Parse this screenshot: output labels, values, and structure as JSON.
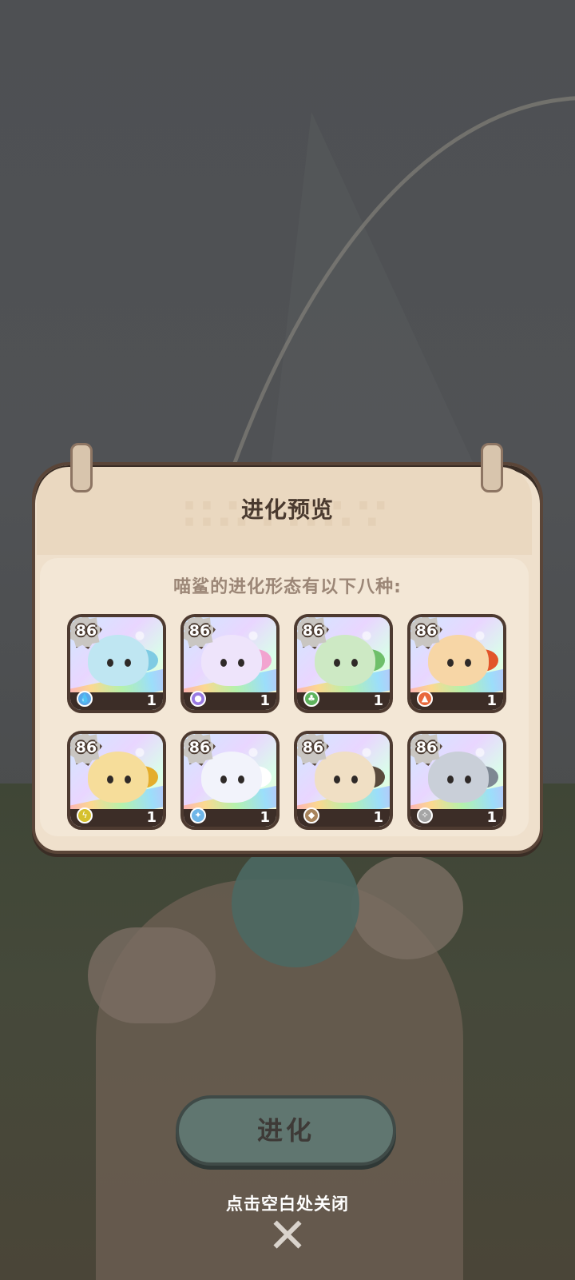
{
  "dialog": {
    "title": "进化预览",
    "subtitle": "喵鲨的进化形态有以下八种:",
    "cards": [
      {
        "level": "86",
        "count": "1",
        "element_icon": "water-icon",
        "element_color": "#5aa7e8",
        "body_color": "#bfe6f2",
        "tail_color": "#7fcbe3"
      },
      {
        "level": "86",
        "count": "1",
        "element_icon": "psychic-icon",
        "element_color": "#9a7be3",
        "body_color": "#eee4fb",
        "tail_color": "#f2a4d0"
      },
      {
        "level": "86",
        "count": "1",
        "element_icon": "grass-icon",
        "element_color": "#5fb35e",
        "body_color": "#cde9c4",
        "tail_color": "#6fbf6a"
      },
      {
        "level": "86",
        "count": "1",
        "element_icon": "fire-icon",
        "element_color": "#e8683c",
        "body_color": "#f7d6a6",
        "tail_color": "#e2552a"
      },
      {
        "level": "86",
        "count": "1",
        "element_icon": "electric-icon",
        "element_color": "#d6c12f",
        "body_color": "#f6dd9a",
        "tail_color": "#e4ad2c"
      },
      {
        "level": "86",
        "count": "1",
        "element_icon": "ice-icon",
        "element_color": "#6fb6e8",
        "body_color": "#f2f3fb",
        "tail_color": "#ffffff"
      },
      {
        "level": "86",
        "count": "1",
        "element_icon": "ground-icon",
        "element_color": "#a8845c",
        "body_color": "#f0dfc4",
        "tail_color": "#5a4a3c"
      },
      {
        "level": "86",
        "count": "1",
        "element_icon": "normal-icon",
        "element_color": "#a5a5a5",
        "body_color": "#c9cfd8",
        "tail_color": "#7e8893"
      }
    ]
  },
  "evolve_button": {
    "label": "进化"
  },
  "close_hint": {
    "text": "点击空白处关闭"
  },
  "colors": {
    "panel": "#efe0cc",
    "panel_border": "#5a4538",
    "button": "#607670"
  }
}
